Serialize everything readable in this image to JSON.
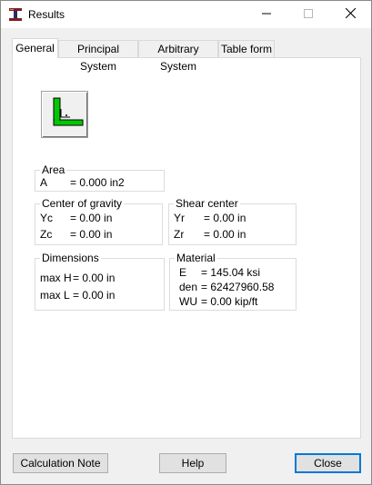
{
  "window": {
    "title": "Results",
    "icon": "results-app-icon",
    "controls": {
      "minimize": "minimize-icon",
      "maximize": "maximize-icon",
      "close": "close-icon"
    }
  },
  "tabs": [
    {
      "label": "General",
      "active": true
    },
    {
      "label": "Principal System",
      "active": false
    },
    {
      "label": "Arbitrary System",
      "active": false
    },
    {
      "label": "Table form",
      "active": false
    }
  ],
  "section_icon": {
    "name": "angle-section-icon",
    "color": "#00c800"
  },
  "area": {
    "legend": "Area",
    "rows": [
      {
        "label": "A",
        "value": "= 0.000 in2"
      }
    ]
  },
  "center_of_gravity": {
    "legend": "Center of gravity",
    "rows": [
      {
        "label": "Yc",
        "value": "= 0.00 in"
      },
      {
        "label": "Zc",
        "value": "= 0.00 in"
      }
    ]
  },
  "shear_center": {
    "legend": "Shear center",
    "rows": [
      {
        "label": "Yr",
        "value": "= 0.00 in"
      },
      {
        "label": "Zr",
        "value": "= 0.00 in"
      }
    ]
  },
  "dimensions": {
    "legend": "Dimensions",
    "rows": [
      {
        "label": "max H",
        "value": "= 0.00 in"
      },
      {
        "label": "max L",
        "value": "= 0.00 in"
      }
    ]
  },
  "material": {
    "legend": "Material",
    "rows": [
      {
        "label": "E",
        "value": "= 145.04 ksi"
      },
      {
        "label": "den",
        "value": "= 62427960.58"
      },
      {
        "label": "WU",
        "value": "= 0.00 kip/ft"
      }
    ]
  },
  "buttons": {
    "calculation_note": "Calculation Note",
    "help": "Help",
    "close": "Close"
  }
}
